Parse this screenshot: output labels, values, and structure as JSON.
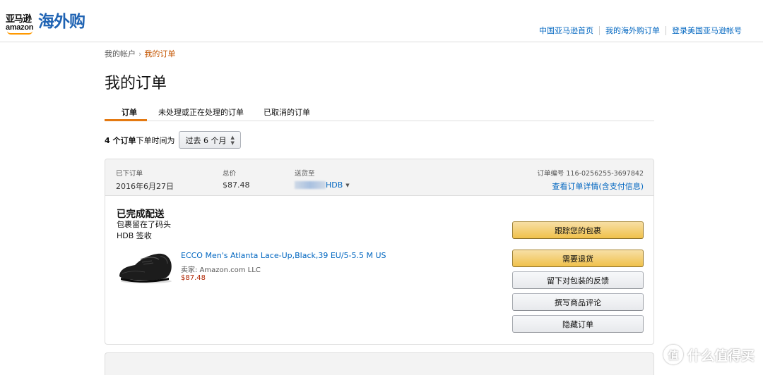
{
  "logo": {
    "cn_small": "亚马逊",
    "en": "amazon",
    "cn_big": "海外购"
  },
  "top_links": [
    "中国亚马逊首页",
    "我的海外购订单",
    "登录美国亚马逊帐号"
  ],
  "breadcrumb": {
    "parent": "我的帐户",
    "separator": "›",
    "current": "我的订单"
  },
  "page_title": "我的订单",
  "tabs": [
    "订单",
    "未处理或正在处理的订单",
    "已取消的订单"
  ],
  "filter": {
    "count": "4 个订单",
    "text": "下单时间为",
    "selected": "过去 6 个月"
  },
  "order": {
    "placed_label": "已下订单",
    "placed_value": "2016年6月27日",
    "total_label": "总价",
    "total_value": "$87.48",
    "ship_label": "送货至",
    "ship_name": "HDB",
    "order_no_label": "订单编号 116-0256255-3697842",
    "details_link": "查看订单详情(含支付信息)",
    "status_title": "已完成配送",
    "status_line1": "包裹留在了码头",
    "status_line2": "HDB 签收",
    "product_title": "ECCO Men's Atlanta Lace-Up,Black,39 EU/5-5.5 M US",
    "seller": "卖家: Amazon.com LLC",
    "price": "$87.48",
    "buttons": [
      "跟踪您的包裹",
      "需要退货",
      "留下对包装的反馈",
      "撰写商品评论",
      "隐藏订单"
    ]
  },
  "watermark": {
    "icon": "值",
    "text": "什么值得买"
  },
  "colors": {
    "link": "#0066c0",
    "accent": "#e47911",
    "price": "#b12704",
    "logo_blue": "#1f63b3"
  }
}
